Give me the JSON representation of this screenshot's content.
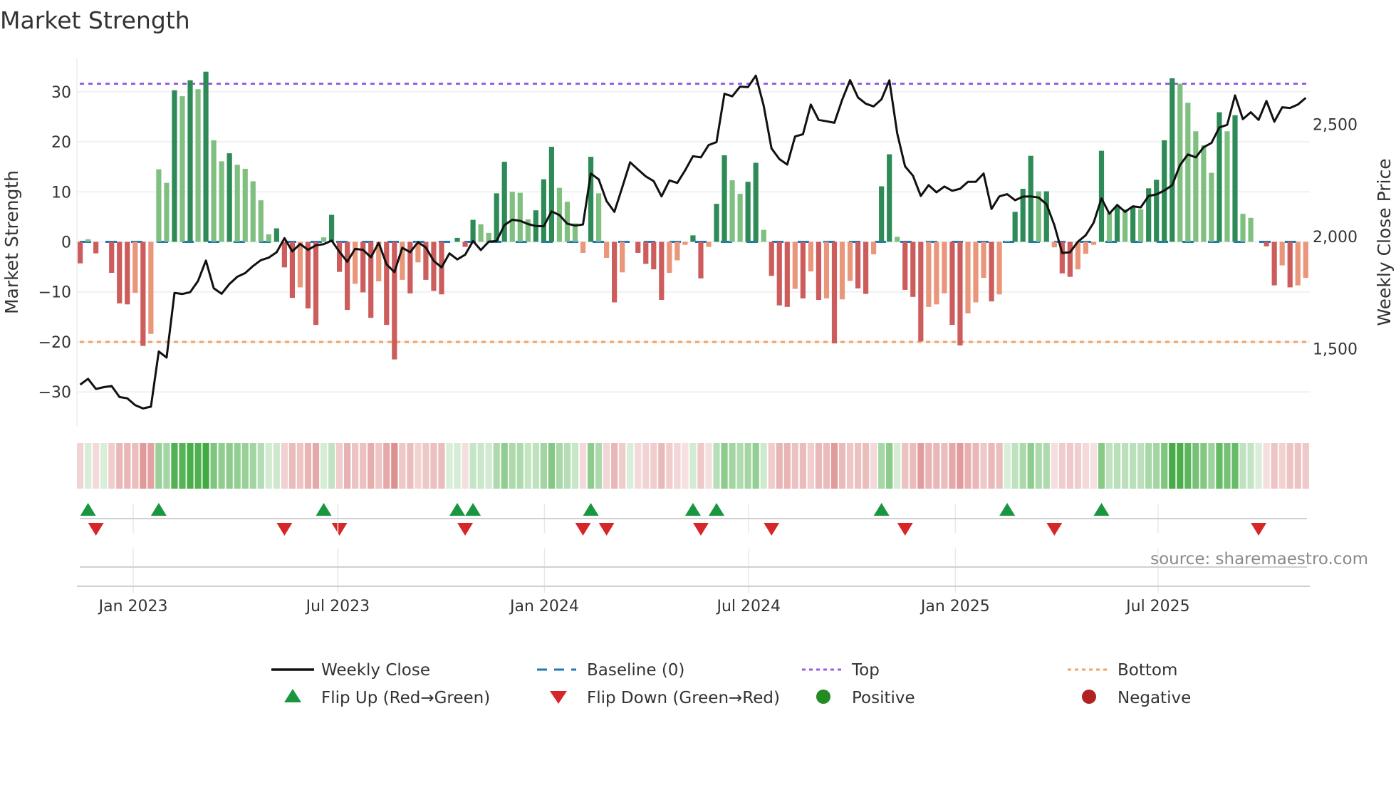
{
  "title": "Market Strength",
  "source": "source: sharemaestro.com",
  "colors": {
    "pos_strong": "#2e8b57",
    "pos_weak": "#7fbf7f",
    "neg_strong": "#cd5c5c",
    "neg_weak": "#e9967a",
    "close_line": "#111111",
    "baseline": "#1f77b4",
    "top": "#9b5de5",
    "bottom": "#f4a261",
    "flip_up": "#1a9641",
    "flip_down": "#d62728",
    "positive": "#228b22",
    "negative": "#b22222",
    "heat_pos": "#2ca02c",
    "heat_neg": "#cd5c5c"
  },
  "legend": {
    "weekly_close": "Weekly Close",
    "baseline": "Baseline (0)",
    "top": "Top",
    "bottom": "Bottom",
    "flip_up": "Flip Up (Red→Green)",
    "flip_down": "Flip Down (Green→Red)",
    "positive": "Positive",
    "negative": "Negative"
  },
  "chart_data": {
    "type": "bar",
    "title": "Market Strength",
    "ylabel": "Market Strength",
    "y2label": "Weekly Close Price",
    "ylim": [
      -36.8,
      36.8
    ],
    "y2lim": [
      1156,
      2797
    ],
    "yticks": [
      30,
      20,
      10,
      0,
      -10,
      -20,
      -30
    ],
    "ytick_labels": [
      "30",
      "20",
      "10",
      "0",
      "−10",
      "−20",
      "−30"
    ],
    "y2ticks": [
      2500,
      2000,
      1500
    ],
    "y2tick_labels": [
      "2,500",
      "2,000",
      "1,500"
    ],
    "top_level": 31.6,
    "bottom_level": -20,
    "baseline": 0,
    "grid": true,
    "legend_position": "bottom",
    "x_unit": "week index",
    "xticks": [
      {
        "label": "Jan 2023",
        "week": 6.75
      },
      {
        "label": "Jul 2023",
        "week": 32.8
      },
      {
        "label": "Jan 2024",
        "week": 59.1
      },
      {
        "label": "Jul 2024",
        "week": 85.1
      },
      {
        "label": "Jan 2025",
        "week": 111.4
      },
      {
        "label": "Jul 2025",
        "week": 137.2
      }
    ],
    "strength": [
      -4.3,
      0.5,
      -2.3,
      0,
      -6.2,
      -12.3,
      -12.5,
      -10.2,
      -20.8,
      -18.4,
      14.5,
      11.8,
      30.3,
      29.1,
      32.3,
      30.5,
      34,
      20.3,
      16.1,
      17.7,
      15.4,
      14.6,
      12.1,
      8.3,
      1.5,
      2.7,
      -5.1,
      -11.2,
      -9.1,
      -13.3,
      -16.6,
      0.9,
      5.4,
      -6,
      -13.6,
      -8.4,
      -10.1,
      -15.2,
      -7.9,
      -16.6,
      -23.5,
      -7.6,
      -10.3,
      -4.1,
      -7.6,
      -9.8,
      -10.5,
      0,
      0.8,
      -1,
      4.4,
      3.5,
      1.8,
      9.7,
      16,
      10,
      9.8,
      4.5,
      6.3,
      12.5,
      19,
      10.8,
      8,
      3.7,
      -2.2,
      17,
      9.7,
      -3.2,
      -12.1,
      -6.1,
      0,
      -2.2,
      -4.4,
      -5.5,
      -11.6,
      -6.2,
      -3.7,
      -0.6,
      1.3,
      -7.3,
      -1,
      7.6,
      17.3,
      12.3,
      9.6,
      12,
      15.8,
      2.4,
      -6.8,
      -12.7,
      -13,
      -9.4,
      -11.3,
      -5.9,
      -11.6,
      -11.3,
      -20.3,
      -11.5,
      -7.8,
      -9.3,
      -10.4,
      -2.5,
      11.1,
      17.5,
      1,
      -9.6,
      -11,
      -19.9,
      -13,
      -12.5,
      -10.3,
      -16.6,
      -20.7,
      -14.3,
      -12.1,
      -7.2,
      -11.9,
      -10.5,
      0.2,
      6,
      10.6,
      17.2,
      10.1,
      10.1,
      -1.1,
      -6.3,
      -7,
      -5.5,
      -2.4,
      -0.6,
      18.2,
      5.8,
      7,
      6.5,
      7,
      6.5,
      10.7,
      12.4,
      20.3,
      32.7,
      31.6,
      27.8,
      22.1,
      19.3,
      13.8,
      25.9,
      22.1,
      25.3,
      5.6,
      4.8,
      0,
      -0.9,
      -8.7,
      -4.7,
      -9.1,
      -8.7,
      -7.2
    ],
    "weekly_close": [
      1340,
      1366,
      1321,
      1329,
      1334,
      1285,
      1279,
      1249,
      1234,
      1242,
      1488,
      1461,
      1749,
      1744,
      1752,
      1802,
      1893,
      1770,
      1745,
      1789,
      1821,
      1837,
      1869,
      1895,
      1906,
      1930,
      1993,
      1934,
      1967,
      1941,
      1961,
      1966,
      1982,
      1932,
      1888,
      1945,
      1941,
      1908,
      1972,
      1876,
      1842,
      1950,
      1930,
      1975,
      1951,
      1892,
      1863,
      1925,
      1898,
      1919,
      1980,
      1940,
      1977,
      1980,
      2051,
      2075,
      2070,
      2056,
      2047,
      2046,
      2112,
      2096,
      2057,
      2049,
      2054,
      2281,
      2255,
      2158,
      2110,
      2220,
      2331,
      2299,
      2268,
      2247,
      2179,
      2250,
      2239,
      2295,
      2358,
      2353,
      2408,
      2421,
      2636,
      2625,
      2668,
      2666,
      2717,
      2583,
      2393,
      2345,
      2321,
      2446,
      2456,
      2588,
      2520,
      2514,
      2507,
      2610,
      2697,
      2620,
      2592,
      2580,
      2612,
      2696,
      2460,
      2313,
      2271,
      2181,
      2229,
      2197,
      2223,
      2204,
      2213,
      2244,
      2244,
      2281,
      2123,
      2179,
      2189,
      2162,
      2178,
      2179,
      2174,
      2144,
      2051,
      1927,
      1930,
      1977,
      2006,
      2062,
      2170,
      2102,
      2141,
      2110,
      2135,
      2130,
      2181,
      2188,
      2205,
      2229,
      2319,
      2366,
      2353,
      2398,
      2417,
      2486,
      2498,
      2629,
      2523,
      2554,
      2520,
      2604,
      2512,
      2576,
      2573,
      2588,
      2618
    ],
    "flip_up_weeks": [
      1,
      10,
      31,
      48,
      50,
      65,
      78,
      81,
      102,
      118,
      130
    ],
    "flip_down_weeks": [
      2,
      26,
      33,
      49,
      64,
      67,
      79,
      88,
      105,
      124,
      150
    ]
  }
}
